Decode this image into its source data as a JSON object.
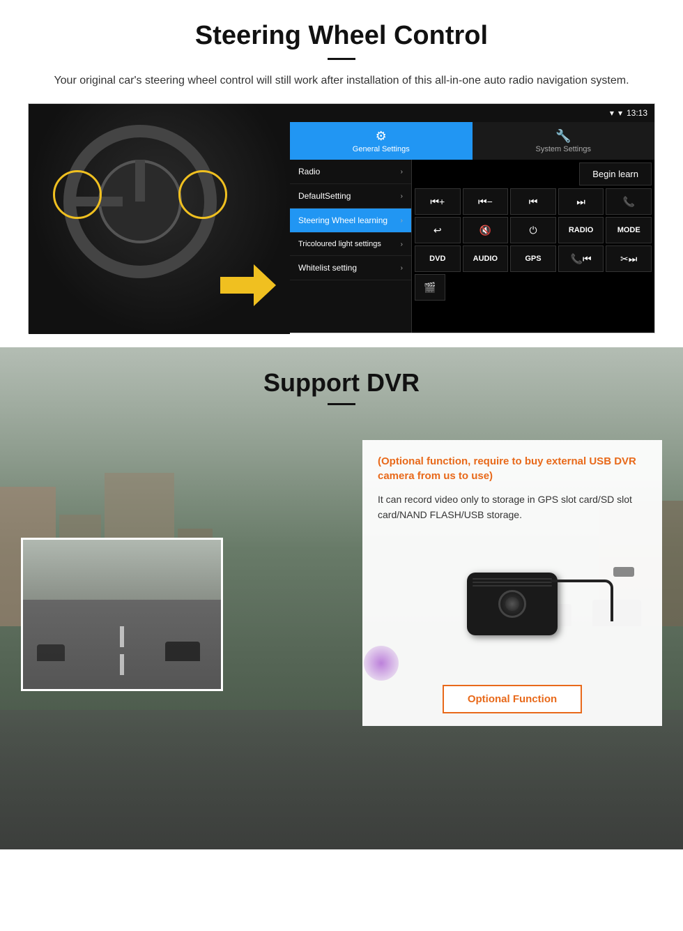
{
  "steering": {
    "title": "Steering Wheel Control",
    "description": "Your original car's steering wheel control will still work after installation of this all-in-one auto radio navigation system.",
    "statusbar": {
      "time": "13:13"
    },
    "tabs": {
      "general": "General Settings",
      "system": "System Settings"
    },
    "menu": {
      "items": [
        {
          "label": "Radio",
          "active": false
        },
        {
          "label": "DefaultSetting",
          "active": false
        },
        {
          "label": "Steering Wheel learning",
          "active": true
        },
        {
          "label": "Tricoloured light settings",
          "active": false
        },
        {
          "label": "Whitelist setting",
          "active": false
        }
      ]
    },
    "begin_learn": "Begin learn",
    "control_buttons": {
      "row1": [
        "⏮+",
        "⏮-",
        "⏮⏮",
        "⏭⏭",
        "📞"
      ],
      "row2": [
        "↩",
        "🔇",
        "⏻",
        "RADIO",
        "MODE"
      ],
      "row3": [
        "DVD",
        "AUDIO",
        "GPS",
        "📞⏮",
        "✂⏭"
      ],
      "row4": [
        "🎬"
      ]
    }
  },
  "dvr": {
    "title": "Support DVR",
    "optional_text": "(Optional function, require to buy external USB DVR camera from us to use)",
    "description": "It can record video only to storage in GPS slot card/SD slot card/NAND FLASH/USB storage.",
    "optional_function_label": "Optional Function"
  }
}
